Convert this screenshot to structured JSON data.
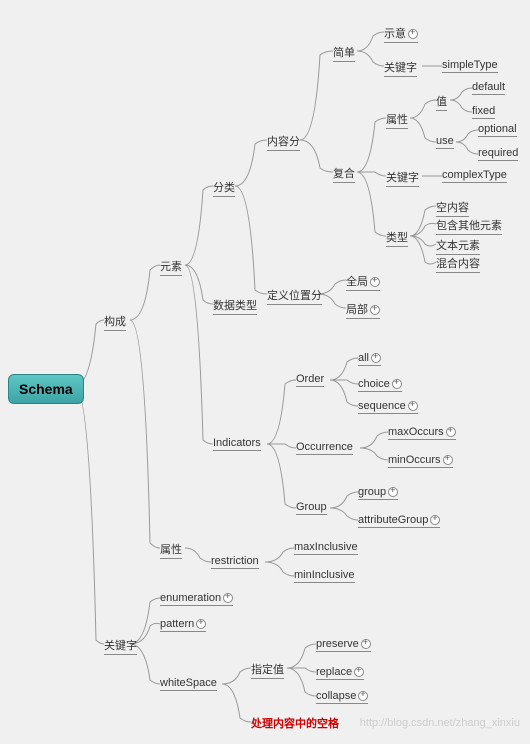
{
  "root": "Schema",
  "wm": "http://blog.csdn.net/zhang_xinxiu",
  "n": {
    "gc": "构成",
    "yy": "元素",
    "fl": "分类",
    "nrf": "内容分",
    "dw": "定义位置分",
    "jd": "简单",
    "fh": "复合",
    "sy": "示意",
    "gjz1": "关键字",
    "st": "simpleType",
    "sx": "属性",
    "gjz2": "关键字",
    "lx": "类型",
    "zhi": "值",
    "use": "use",
    "def": "default",
    "fix": "fixed",
    "opt": "optional",
    "req": "required",
    "ct": "complexType",
    "knr": "空内容",
    "bhq": "包含其他元素",
    "wby": "文本元素",
    "hhn": "混合内容",
    "qj": "全局",
    "jb": "局部",
    "sjlx": "数据类型",
    "ind": "Indicators",
    "ord": "Order",
    "occ": "Occurrence",
    "grp": "Group",
    "all": "all",
    "cho": "choice",
    "seq": "sequence",
    "max": "maxOccurs",
    "min": "minOccurs",
    "grp2": "group",
    "ag": "attributeGroup",
    "sx2": "属性",
    "res": "restriction",
    "mxi": "maxInclusive",
    "mni": "minInclusive",
    "gjz": "关键字",
    "enu": "enumeration",
    "pat": "pattern",
    "ws": "whiteSpace",
    "zdz": "指定值",
    "pre": "preserve",
    "rep": "replace",
    "col": "collapse",
    "note": "处理内容中的空格"
  }
}
